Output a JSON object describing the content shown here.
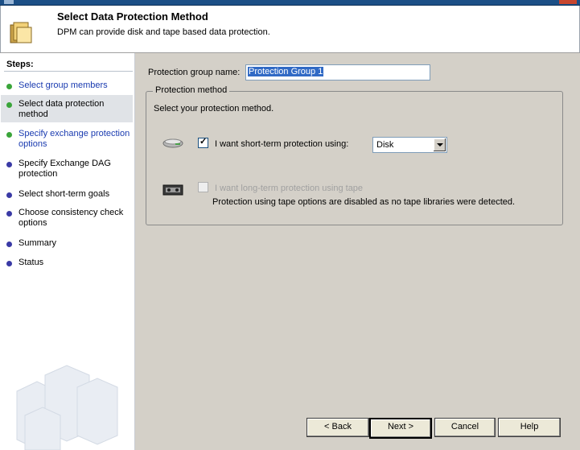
{
  "header": {
    "title": "Select Data Protection Method",
    "description": "DPM can provide disk and tape based data protection.",
    "icon": "folder-shield-icon"
  },
  "sidebar": {
    "heading": "Steps:",
    "colors": {
      "completed": "#3aa53a",
      "pending": "#3a3aa5"
    },
    "steps": [
      {
        "label": "Select group members",
        "state": "completed",
        "link": true
      },
      {
        "label": "Select data protection method",
        "state": "current",
        "link": false
      },
      {
        "label": "Specify exchange protection options",
        "state": "completed",
        "link": true
      },
      {
        "label": "Specify Exchange DAG protection",
        "state": "pending",
        "link": false
      },
      {
        "label": "Select short-term goals",
        "state": "pending",
        "link": false
      },
      {
        "label": "Choose consistency check options",
        "state": "pending",
        "link": false
      },
      {
        "label": "Summary",
        "state": "pending",
        "link": false
      },
      {
        "label": "Status",
        "state": "pending",
        "link": false
      }
    ]
  },
  "main": {
    "group_name_label": "Protection group name:",
    "group_name_value": "Protection Group 1",
    "method": {
      "legend": "Protection method",
      "intro": "Select your protection method.",
      "short_term_label": "I want short-term protection using:",
      "short_term_checked": true,
      "short_term_option": "Disk",
      "long_term_label": "I want long-term protection using tape",
      "long_term_checked": false,
      "long_term_enabled": false,
      "tape_note": "Protection using tape options are disabled as no tape libraries were detected."
    }
  },
  "buttons": {
    "back": "< Back",
    "next": "Next >",
    "cancel": "Cancel",
    "help": "Help"
  }
}
